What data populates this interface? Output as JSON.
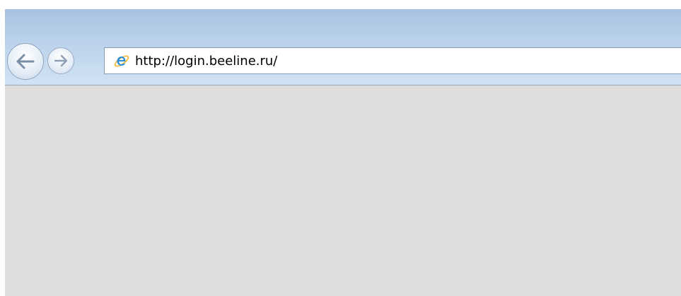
{
  "browser": {
    "address_bar": {
      "url": "http://login.beeline.ru/"
    },
    "icons": {
      "back": "back-arrow-icon",
      "forward": "forward-arrow-icon",
      "site": "internet-explorer-logo-icon"
    },
    "colors": {
      "content_background": "#dedede",
      "chrome_top": "#a7c3e1",
      "chrome_bottom": "#d2e3f4"
    }
  }
}
